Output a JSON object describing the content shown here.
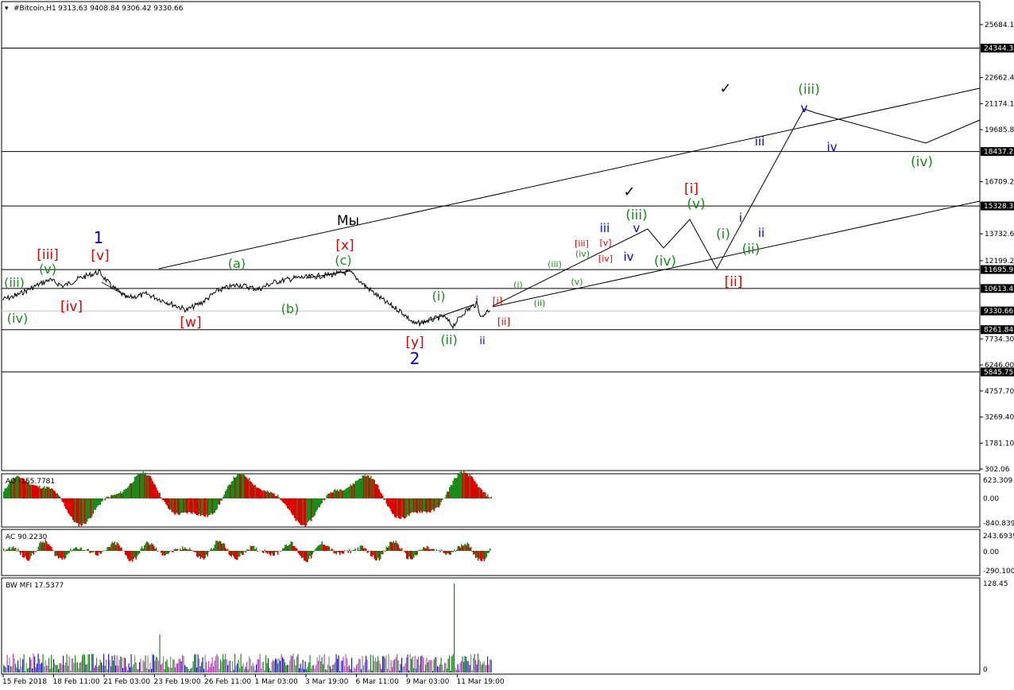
{
  "header": {
    "symbol": "#Bitcoin,H1",
    "ohlc": "9313.63 9408.84 9306.42 9330.66"
  },
  "chart_data": {
    "type": "line",
    "main": {
      "price_labels": [
        "25684.10",
        "24344.30",
        "22662.40",
        "21174.10",
        "19685.80",
        "18437.21",
        "16709.20",
        "15328.35",
        "13732.60",
        "12199.20",
        "11695.96",
        "10613.47",
        "9330.66",
        "8261.84",
        "7734.30",
        "6246.00",
        "5845.75",
        "4757.70",
        "3269.40",
        "1781.10",
        "302.06"
      ],
      "hlines": [
        {
          "label": "24344.30",
          "price": 24344.3
        },
        {
          "label": "18437.21",
          "price": 18437.21
        },
        {
          "label": "15328.35",
          "price": 15328.35
        },
        {
          "label": "11695.96",
          "price": 11695.96
        },
        {
          "label": "10613.47",
          "price": 10613.47
        },
        {
          "label": "8261.84",
          "price": 8261.84
        },
        {
          "label": "5845.75",
          "price": 5845.75
        }
      ],
      "current_price": "9330.66"
    },
    "date_labels": [
      "15 Feb 2018",
      "18 Feb 11:00",
      "21 Feb 03:00",
      "23 Feb 19:00",
      "26 Feb 11:00",
      "1 Mar 03:00",
      "3 Mar 19:00",
      "6 Mar 11:00",
      "9 Mar 03:00",
      "11 Mar 19:00"
    ],
    "annotations": {
      "caption": "Мы",
      "blue": [
        "1",
        "2",
        "iii",
        "v",
        "iv",
        "i",
        "ii",
        "i",
        "ii",
        "iii",
        "iv",
        "v"
      ],
      "red": [
        "[iii]",
        "[v]",
        "[iv]",
        "[w]",
        "[x]",
        "[y]",
        "[i]",
        "[ii]",
        "[iii]",
        "[v]",
        "[iv]",
        "[i]",
        "[ii]"
      ],
      "green": [
        "(iii)",
        "(v)",
        "(iv)",
        "(a)",
        "(b)",
        "(c)",
        "(i)",
        "(ii)",
        "(i)",
        "(ii)",
        "(iii)",
        "(iv)",
        "(v)",
        "(iii)",
        "(iv)",
        "(v)",
        "(i)",
        "(ii)",
        "(iii)",
        "(iv)"
      ],
      "checks": [
        "✓",
        "✓"
      ]
    },
    "indicators": [
      {
        "name": "AO",
        "label": "AO -155.7781",
        "ticks": [
          "623.309",
          "0.00",
          "-840.839"
        ]
      },
      {
        "name": "AC",
        "label": "AC 90.2230",
        "ticks": [
          "243.6939",
          "0.00",
          "-290.1009"
        ]
      },
      {
        "name": "BW MFI",
        "label": "BW MFI 17.5377",
        "ticks": [
          "128.45",
          "0"
        ]
      }
    ]
  }
}
